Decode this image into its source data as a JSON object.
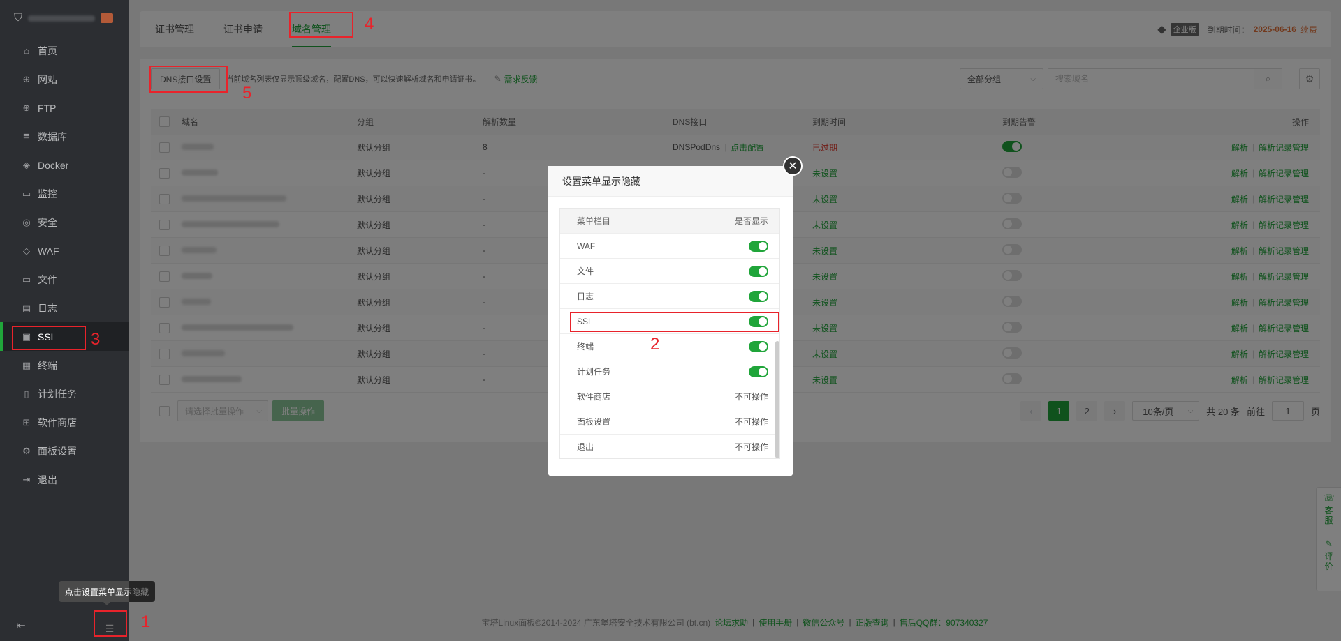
{
  "sidebar": {
    "items": [
      {
        "label": "首页",
        "icon": "home-icon",
        "glyph": "⌂"
      },
      {
        "label": "网站",
        "icon": "globe-icon",
        "glyph": "⊕"
      },
      {
        "label": "FTP",
        "icon": "ftp-icon",
        "glyph": "⊕"
      },
      {
        "label": "数据库",
        "icon": "database-icon",
        "glyph": "≣"
      },
      {
        "label": "Docker",
        "icon": "docker-icon",
        "glyph": "◈"
      },
      {
        "label": "监控",
        "icon": "monitor-icon",
        "glyph": "▭"
      },
      {
        "label": "安全",
        "icon": "shield-icon",
        "glyph": "◎"
      },
      {
        "label": "WAF",
        "icon": "waf-icon",
        "glyph": "◇"
      },
      {
        "label": "文件",
        "icon": "folder-icon",
        "glyph": "▭"
      },
      {
        "label": "日志",
        "icon": "log-icon",
        "glyph": "▤"
      },
      {
        "label": "SSL",
        "icon": "ssl-icon",
        "glyph": "▣"
      },
      {
        "label": "终端",
        "icon": "terminal-icon",
        "glyph": "▦"
      },
      {
        "label": "计划任务",
        "icon": "schedule-icon",
        "glyph": "▯"
      },
      {
        "label": "软件商店",
        "icon": "store-icon",
        "glyph": "⊞"
      },
      {
        "label": "面板设置",
        "icon": "settings-icon",
        "glyph": "⚙"
      },
      {
        "label": "退出",
        "icon": "logout-icon",
        "glyph": "⇥"
      }
    ],
    "active_index": 10,
    "tooltip": "点击设置菜单显示隐藏"
  },
  "tabs": [
    "证书管理",
    "证书申请",
    "域名管理"
  ],
  "active_tab": 2,
  "license": {
    "badge": "企业版",
    "expire_label": "到期时间：",
    "expire_date": "2025-06-16",
    "renew": "续费"
  },
  "toolbar": {
    "dns_button": "DNS接口设置",
    "description": "当前域名列表仅显示顶级域名，配置DNS，可以快速解析域名和申请证书。",
    "feedback": "需求反馈",
    "group_select": "全部分组",
    "search_placeholder": "搜索域名"
  },
  "table": {
    "headers": {
      "name": "域名",
      "group": "分组",
      "count": "解析数量",
      "dns": "DNS接口",
      "expire": "到期时间",
      "alert": "到期告警",
      "ops": "操作"
    },
    "rows": [
      {
        "group": "默认分组",
        "count": "8",
        "dns": "DNSPodDns",
        "dns_action": "点击配置",
        "expire": "已过期",
        "alert_on": true
      },
      {
        "group": "默认分组",
        "count": "-",
        "dns": "",
        "dns_action": "",
        "expire": "未设置",
        "alert_on": false
      },
      {
        "group": "默认分组",
        "count": "-",
        "dns": "",
        "dns_action": "",
        "expire": "未设置",
        "alert_on": false
      },
      {
        "group": "默认分组",
        "count": "-",
        "dns": "",
        "dns_action": "",
        "expire": "未设置",
        "alert_on": false
      },
      {
        "group": "默认分组",
        "count": "-",
        "dns": "",
        "dns_action": "",
        "expire": "未设置",
        "alert_on": false
      },
      {
        "group": "默认分组",
        "count": "-",
        "dns": "",
        "dns_action": "",
        "expire": "未设置",
        "alert_on": false
      },
      {
        "group": "默认分组",
        "count": "-",
        "dns": "",
        "dns_action": "",
        "expire": "未设置",
        "alert_on": false
      },
      {
        "group": "默认分组",
        "count": "-",
        "dns": "",
        "dns_action": "",
        "expire": "未设置",
        "alert_on": false
      },
      {
        "group": "默认分组",
        "count": "-",
        "dns": "",
        "dns_action": "",
        "expire": "未设置",
        "alert_on": false
      },
      {
        "group": "默认分组",
        "count": "-",
        "dns": "",
        "dns_action": "",
        "expire": "未设置",
        "alert_on": false
      }
    ],
    "op_resolve": "解析",
    "op_records": "解析记录管理"
  },
  "footer_bar": {
    "batch_placeholder": "请选择批量操作",
    "batch_button": "批量操作",
    "pages": [
      "1",
      "2"
    ],
    "page_size": "10条/页",
    "total": "共 20 条",
    "goto_label": "前往",
    "goto_value": "1",
    "page_unit": "页"
  },
  "modal": {
    "title": "设置菜单显示隐藏",
    "col_item": "菜单栏目",
    "col_show": "是否显示",
    "rows": [
      {
        "label": "WAF",
        "toggle": true,
        "text": ""
      },
      {
        "label": "文件",
        "toggle": true,
        "text": ""
      },
      {
        "label": "日志",
        "toggle": true,
        "text": ""
      },
      {
        "label": "SSL",
        "toggle": true,
        "text": ""
      },
      {
        "label": "终端",
        "toggle": true,
        "text": ""
      },
      {
        "label": "计划任务",
        "toggle": true,
        "text": ""
      },
      {
        "label": "软件商店",
        "toggle": false,
        "text": "不可操作"
      },
      {
        "label": "面板设置",
        "toggle": false,
        "text": "不可操作"
      },
      {
        "label": "退出",
        "toggle": false,
        "text": "不可操作"
      }
    ]
  },
  "annotations": [
    "1",
    "2",
    "3",
    "4",
    "5"
  ],
  "page_footer": {
    "copyright": "宝塔Linux面板©2014-2024 广东堡塔安全技术有限公司 (bt.cn)",
    "links": [
      "论坛求助",
      "使用手册",
      "微信公众号",
      "正版查询",
      "售后QQ群：907340327"
    ]
  },
  "float_help": {
    "service": "客服",
    "review": "评价"
  },
  "colors": {
    "accent": "#20a53a",
    "sidebar_bg": "#2c2e32",
    "annotation": "#e8232b",
    "expired": "#e33b2e",
    "renew": "#e4723a"
  }
}
